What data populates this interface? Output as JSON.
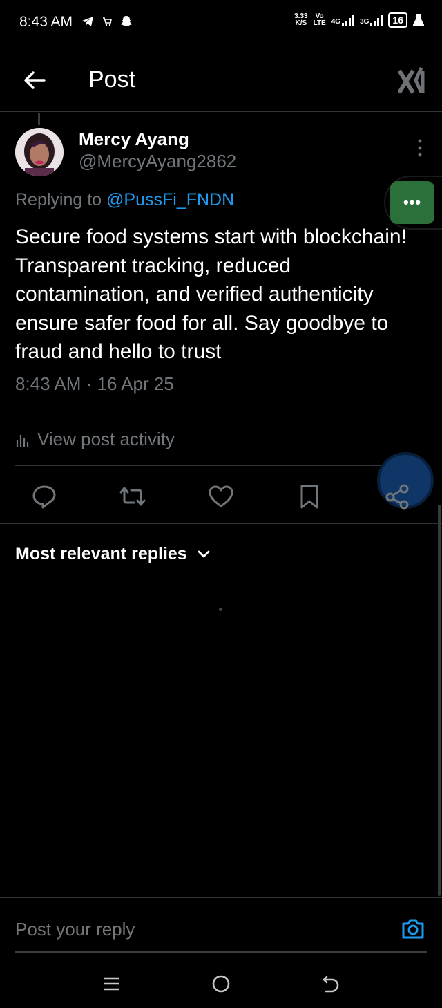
{
  "status_bar": {
    "time": "8:43 AM",
    "net_speed_value": "3.33",
    "net_speed_unit": "K/S",
    "volte_top": "Vo",
    "volte_bottom": "LTE",
    "sim1_type": "4G",
    "sim2_type": "3G",
    "battery": "16",
    "icons": [
      "telegram-icon",
      "cart-icon",
      "snapchat-icon",
      "signal-icon",
      "battery-icon",
      "flask-icon"
    ]
  },
  "header": {
    "title": "Post",
    "back_icon": "arrow-left-icon",
    "logo_icon": "x-logo-icon"
  },
  "post": {
    "author_name": "Mercy Ayang",
    "author_handle": "@MercyAyang2862",
    "replying_prefix": "Replying to ",
    "replying_to": "@PussFi_FNDN",
    "body": "Secure food systems start with blockchain! Transparent tracking, reduced contamination, and verified authenticity ensure safer food for all. Say goodbye to fraud and hello to trust",
    "timestamp": "8:43 AM · 16 Apr 25",
    "activity_label": "View post activity"
  },
  "floating_menu": {
    "label": "•••",
    "color": "#2b6f3a"
  },
  "actions": [
    "reply-icon",
    "repost-icon",
    "like-icon",
    "bookmark-icon",
    "share-icon"
  ],
  "replies": {
    "sort_label": "Most relevant replies"
  },
  "composer": {
    "placeholder": "Post your reply"
  },
  "nav": [
    "menu-icon",
    "home-icon",
    "back-icon"
  ],
  "colors": {
    "accent": "#1d9bf0",
    "muted": "#71767b",
    "text": "#ffffff",
    "divider": "#2f3336",
    "background": "#000000"
  }
}
